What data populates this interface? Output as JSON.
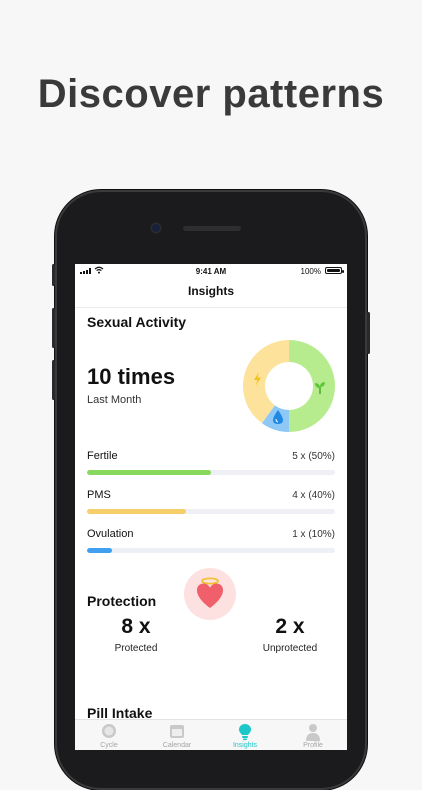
{
  "headline": "Discover patterns",
  "status_bar": {
    "time": "9:41 AM",
    "battery": "100%"
  },
  "nav": {
    "title": "Insights"
  },
  "sexual_activity": {
    "title": "Sexual Activity",
    "count": "10 times",
    "period": "Last Month",
    "donut_icons": [
      "lightning-bolt-icon",
      "sprout-icon",
      "water-drop-icon"
    ],
    "breakdown": [
      {
        "label": "Fertile",
        "value": "5 x (50%)",
        "fraction": 0.5,
        "color": "#86d95a"
      },
      {
        "label": "PMS",
        "value": "4 x (40%)",
        "fraction": 0.4,
        "color": "#f7cf6a"
      },
      {
        "label": "Ovulation",
        "value": "1 x (10%)",
        "fraction": 0.1,
        "color": "#3f9ff0"
      }
    ]
  },
  "protection": {
    "title": "Protection",
    "protected": {
      "count": "8 x",
      "label": "Protected"
    },
    "unprotected": {
      "count": "2 x",
      "label": "Unprotected"
    },
    "icon": "heart-with-halo-icon"
  },
  "pill_intake": {
    "title": "Pill Intake"
  },
  "tabs": [
    {
      "label": "Cycle",
      "icon": "cycle-circle-icon",
      "active": false
    },
    {
      "label": "Calendar",
      "icon": "calendar-icon",
      "active": false
    },
    {
      "label": "Insights",
      "icon": "lightbulb-icon",
      "active": true
    },
    {
      "label": "Profile",
      "icon": "person-icon",
      "active": false
    }
  ],
  "colors": {
    "fertile": "#86d95a",
    "pms": "#f7cf6a",
    "ovulation": "#3f9ff0",
    "accent": "#1cc7c9",
    "heart": "#f0606a"
  }
}
